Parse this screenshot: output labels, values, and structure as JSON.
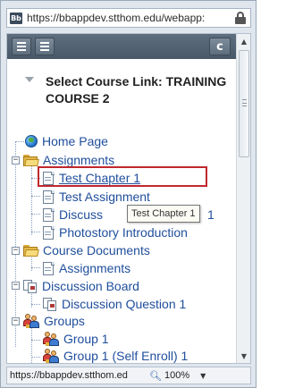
{
  "browser": {
    "favicon": "Bb",
    "url": "https://bbappdev.stthom.edu/webapp:",
    "lock_icon": "lock-icon"
  },
  "toolbar": {
    "left_buttons": [
      "list-view-icon",
      "menu-icon"
    ],
    "refresh_icon": "refresh-icon",
    "refresh_glyph": "c"
  },
  "header": {
    "title": "Select Course Link: TRAINING COURSE 2"
  },
  "tree": {
    "home_page": "Home Page",
    "assignments": "Assignments",
    "test_chapter_1": "Test Chapter 1",
    "test_assignment": "Test Assignment",
    "discussion_partial": "Discuss",
    "discussion_tail": "1",
    "photostory": "Photostory Introduction",
    "course_documents": "Course Documents",
    "course_doc_assignments": "Assignments",
    "discussion_board": "Discussion Board",
    "discussion_question": "Discussion Question 1",
    "groups": "Groups",
    "group_1": "Group 1",
    "group_1_self": "Group 1 (Self Enroll) 1"
  },
  "tooltip": "Test Chapter 1",
  "statusbar": {
    "url": "https://bbappdev.stthom.ed",
    "zoom": "100%"
  },
  "colors": {
    "link": "#1f4e9c",
    "highlight_border": "#c0282e",
    "toolbar": "#546474"
  }
}
